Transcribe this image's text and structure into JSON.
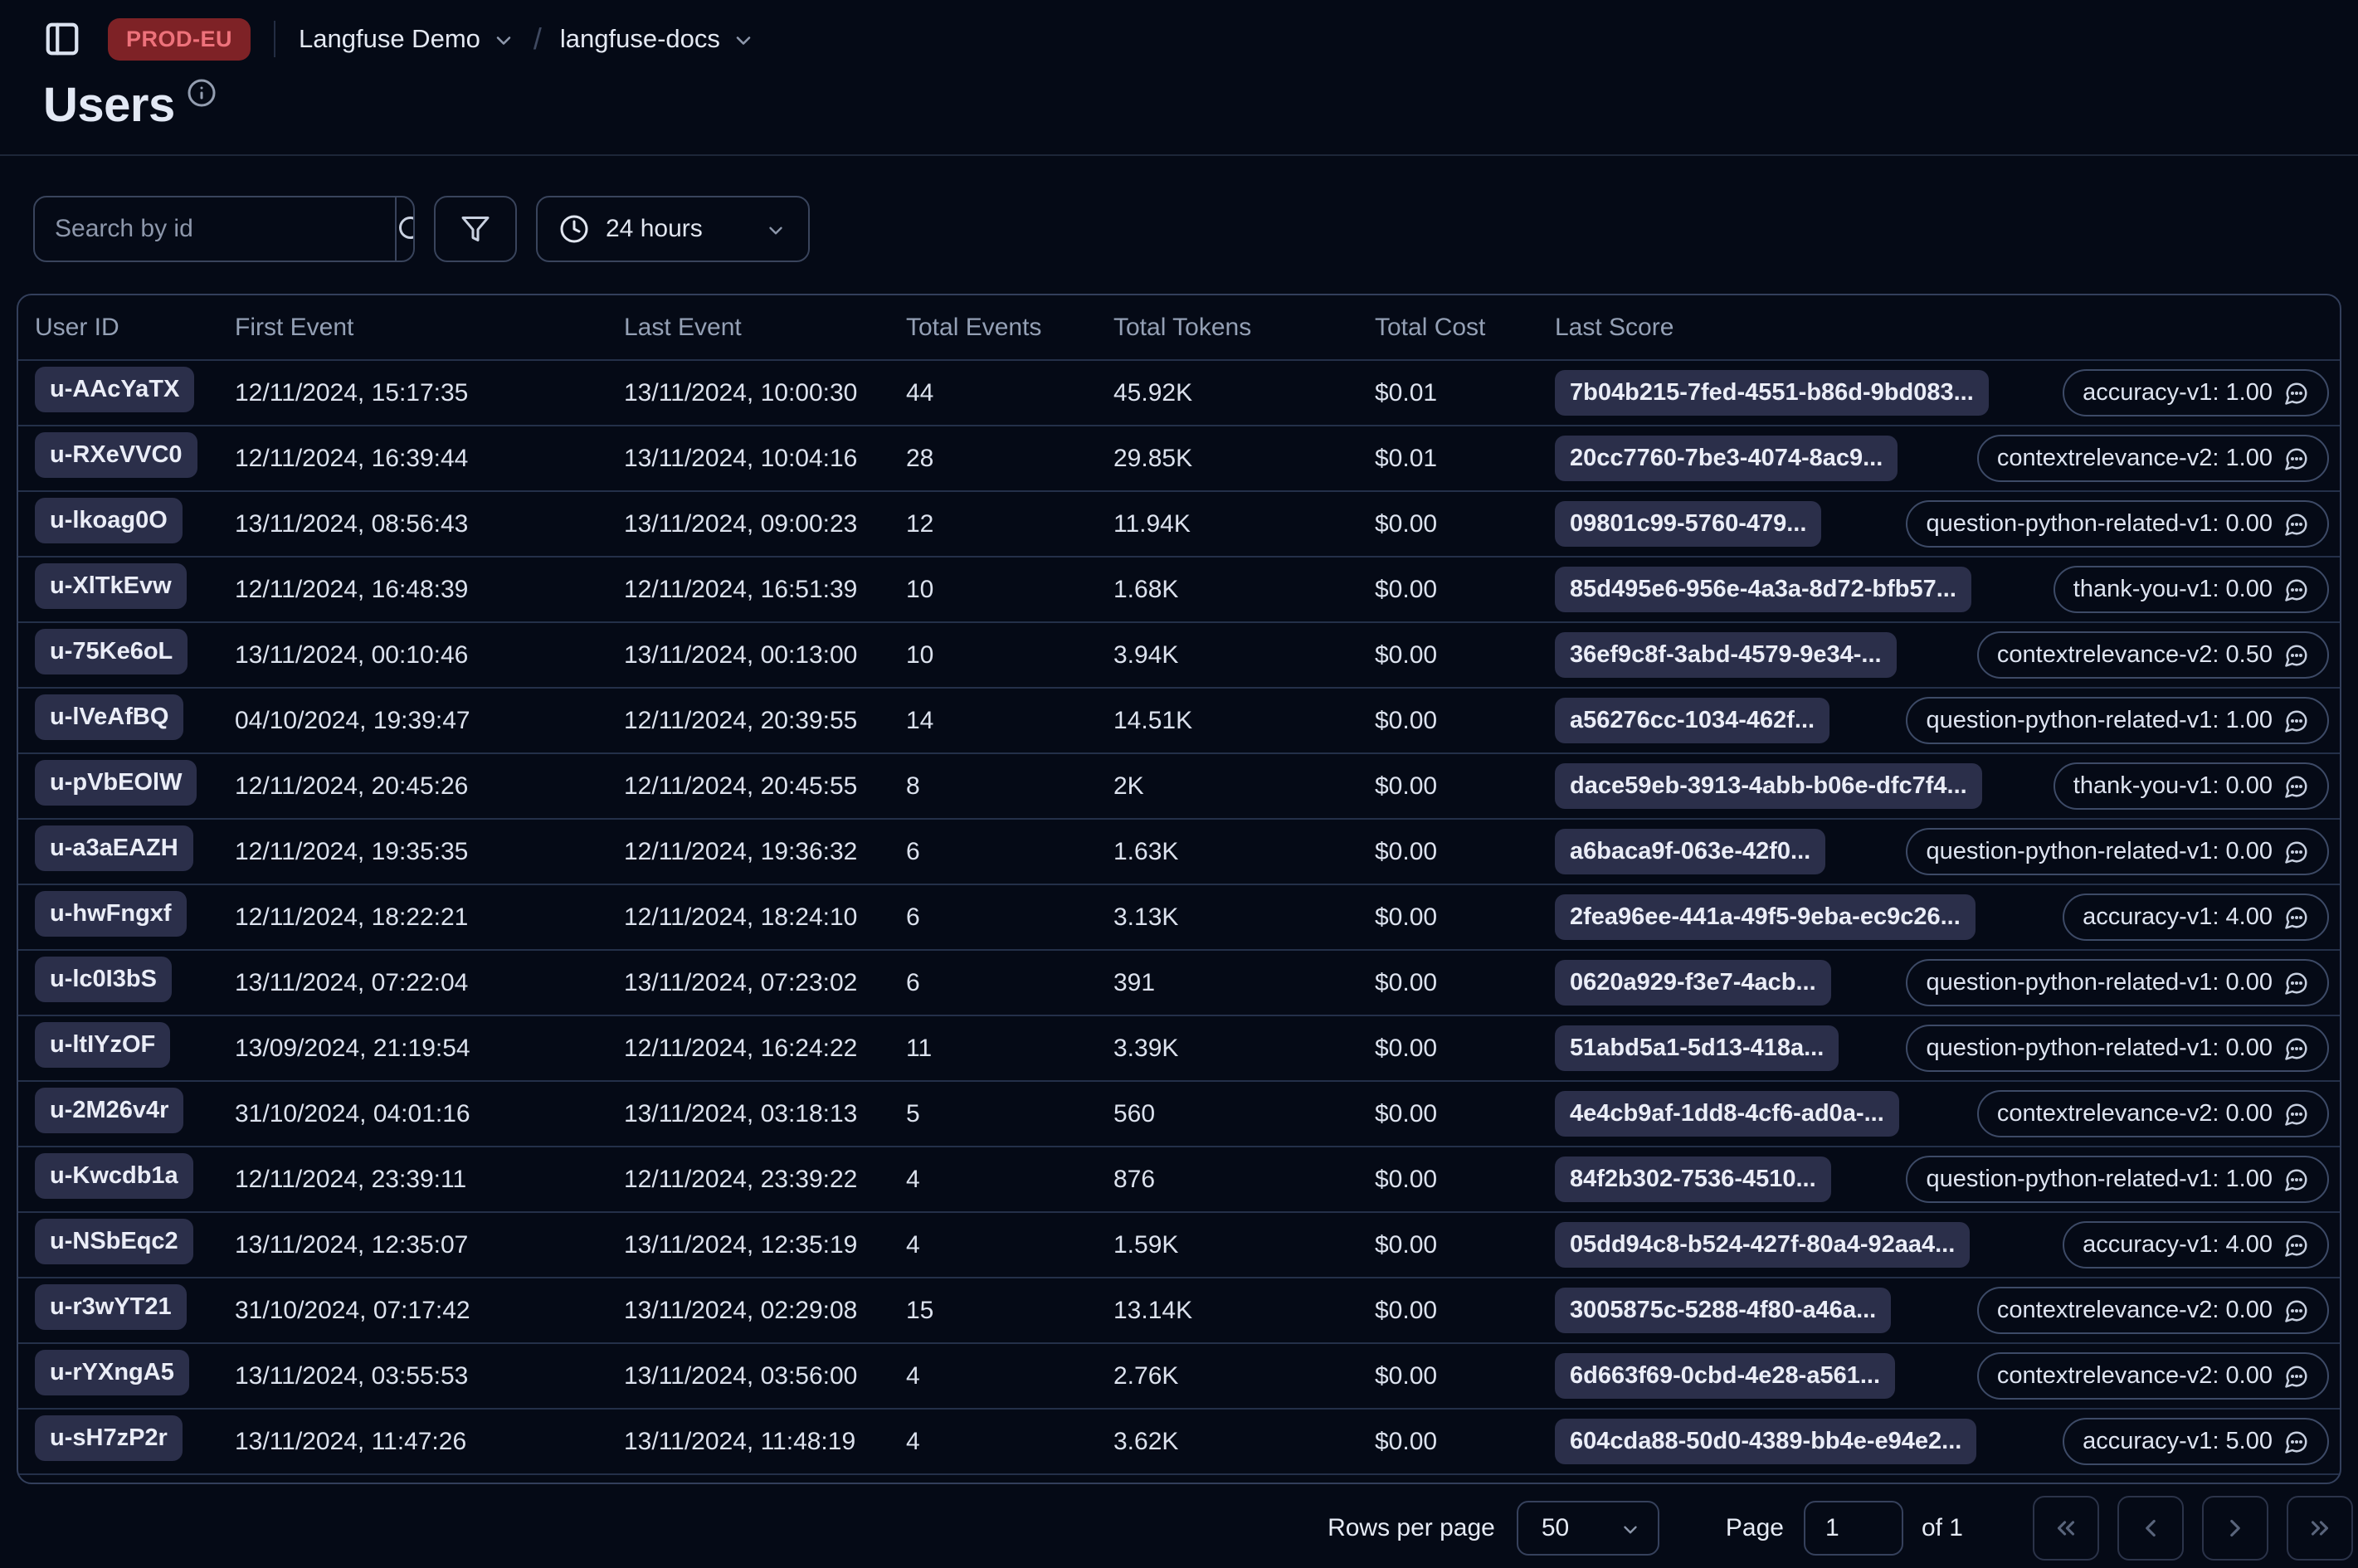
{
  "topbar": {
    "env_badge": "PROD-EU",
    "org": "Langfuse Demo",
    "project": "langfuse-docs"
  },
  "page": {
    "title": "Users"
  },
  "toolbar": {
    "search_placeholder": "Search by id",
    "time_range": "24 hours"
  },
  "table": {
    "columns": [
      "User ID",
      "First Event",
      "Last Event",
      "Total Events",
      "Total Tokens",
      "Total Cost",
      "Last Score"
    ],
    "rows": [
      {
        "user_id": "u-AAcYaTX",
        "first_event": "12/11/2024, 15:17:35",
        "last_event": "13/11/2024, 10:00:30",
        "total_events": "44",
        "total_tokens": "45.92K",
        "total_cost": "$0.01",
        "score_id": "7b04b215-7fed-4551-b86d-9bd083...",
        "score": "accuracy-v1: 1.00"
      },
      {
        "user_id": "u-RXeVVC0",
        "first_event": "12/11/2024, 16:39:44",
        "last_event": "13/11/2024, 10:04:16",
        "total_events": "28",
        "total_tokens": "29.85K",
        "total_cost": "$0.01",
        "score_id": "20cc7760-7be3-4074-8ac9...",
        "score": "contextrelevance-v2: 1.00"
      },
      {
        "user_id": "u-lkoag0O",
        "first_event": "13/11/2024, 08:56:43",
        "last_event": "13/11/2024, 09:00:23",
        "total_events": "12",
        "total_tokens": "11.94K",
        "total_cost": "$0.00",
        "score_id": "09801c99-5760-479...",
        "score": "question-python-related-v1: 0.00"
      },
      {
        "user_id": "u-XlTkEvw",
        "first_event": "12/11/2024, 16:48:39",
        "last_event": "12/11/2024, 16:51:39",
        "total_events": "10",
        "total_tokens": "1.68K",
        "total_cost": "$0.00",
        "score_id": "85d495e6-956e-4a3a-8d72-bfb57...",
        "score": "thank-you-v1: 0.00"
      },
      {
        "user_id": "u-75Ke6oL",
        "first_event": "13/11/2024, 00:10:46",
        "last_event": "13/11/2024, 00:13:00",
        "total_events": "10",
        "total_tokens": "3.94K",
        "total_cost": "$0.00",
        "score_id": "36ef9c8f-3abd-4579-9e34-...",
        "score": "contextrelevance-v2: 0.50"
      },
      {
        "user_id": "u-lVeAfBQ",
        "first_event": "04/10/2024, 19:39:47",
        "last_event": "12/11/2024, 20:39:55",
        "total_events": "14",
        "total_tokens": "14.51K",
        "total_cost": "$0.00",
        "score_id": "a56276cc-1034-462f...",
        "score": "question-python-related-v1: 1.00"
      },
      {
        "user_id": "u-pVbEOlW",
        "first_event": "12/11/2024, 20:45:26",
        "last_event": "12/11/2024, 20:45:55",
        "total_events": "8",
        "total_tokens": "2K",
        "total_cost": "$0.00",
        "score_id": "dace59eb-3913-4abb-b06e-dfc7f4...",
        "score": "thank-you-v1: 0.00"
      },
      {
        "user_id": "u-a3aEAZH",
        "first_event": "12/11/2024, 19:35:35",
        "last_event": "12/11/2024, 19:36:32",
        "total_events": "6",
        "total_tokens": "1.63K",
        "total_cost": "$0.00",
        "score_id": "a6baca9f-063e-42f0...",
        "score": "question-python-related-v1: 0.00"
      },
      {
        "user_id": "u-hwFngxf",
        "first_event": "12/11/2024, 18:22:21",
        "last_event": "12/11/2024, 18:24:10",
        "total_events": "6",
        "total_tokens": "3.13K",
        "total_cost": "$0.00",
        "score_id": "2fea96ee-441a-49f5-9eba-ec9c26...",
        "score": "accuracy-v1: 4.00"
      },
      {
        "user_id": "u-lc0I3bS",
        "first_event": "13/11/2024, 07:22:04",
        "last_event": "13/11/2024, 07:23:02",
        "total_events": "6",
        "total_tokens": "391",
        "total_cost": "$0.00",
        "score_id": "0620a929-f3e7-4acb...",
        "score": "question-python-related-v1: 0.00"
      },
      {
        "user_id": "u-ltIYzOF",
        "first_event": "13/09/2024, 21:19:54",
        "last_event": "12/11/2024, 16:24:22",
        "total_events": "11",
        "total_tokens": "3.39K",
        "total_cost": "$0.00",
        "score_id": "51abd5a1-5d13-418a...",
        "score": "question-python-related-v1: 0.00"
      },
      {
        "user_id": "u-2M26v4r",
        "first_event": "31/10/2024, 04:01:16",
        "last_event": "13/11/2024, 03:18:13",
        "total_events": "5",
        "total_tokens": "560",
        "total_cost": "$0.00",
        "score_id": "4e4cb9af-1dd8-4cf6-ad0a-...",
        "score": "contextrelevance-v2: 0.00"
      },
      {
        "user_id": "u-Kwcdb1a",
        "first_event": "12/11/2024, 23:39:11",
        "last_event": "12/11/2024, 23:39:22",
        "total_events": "4",
        "total_tokens": "876",
        "total_cost": "$0.00",
        "score_id": "84f2b302-7536-4510...",
        "score": "question-python-related-v1: 1.00"
      },
      {
        "user_id": "u-NSbEqc2",
        "first_event": "13/11/2024, 12:35:07",
        "last_event": "13/11/2024, 12:35:19",
        "total_events": "4",
        "total_tokens": "1.59K",
        "total_cost": "$0.00",
        "score_id": "05dd94c8-b524-427f-80a4-92aa4...",
        "score": "accuracy-v1: 4.00"
      },
      {
        "user_id": "u-r3wYT21",
        "first_event": "31/10/2024, 07:17:42",
        "last_event": "13/11/2024, 02:29:08",
        "total_events": "15",
        "total_tokens": "13.14K",
        "total_cost": "$0.00",
        "score_id": "3005875c-5288-4f80-a46a...",
        "score": "contextrelevance-v2: 0.00"
      },
      {
        "user_id": "u-rYXngA5",
        "first_event": "13/11/2024, 03:55:53",
        "last_event": "13/11/2024, 03:56:00",
        "total_events": "4",
        "total_tokens": "2.76K",
        "total_cost": "$0.00",
        "score_id": "6d663f69-0cbd-4e28-a561...",
        "score": "contextrelevance-v2: 0.00"
      },
      {
        "user_id": "u-sH7zP2r",
        "first_event": "13/11/2024, 11:47:26",
        "last_event": "13/11/2024, 11:48:19",
        "total_events": "4",
        "total_tokens": "3.62K",
        "total_cost": "$0.00",
        "score_id": "604cda88-50d0-4389-bb4e-e94e2...",
        "score": "accuracy-v1: 5.00"
      }
    ]
  },
  "pagination": {
    "rows_per_page_label": "Rows per page",
    "rows_per_page": "50",
    "page_label": "Page",
    "page": "1",
    "of_label": "of 1"
  },
  "icons": [
    "panel-left-icon",
    "info-icon",
    "search-icon",
    "filter-icon",
    "clock-icon",
    "chevron-down-icon",
    "comment-icon",
    "chevrons-left-icon",
    "chevron-left-icon",
    "chevron-right-icon",
    "chevrons-right-icon"
  ],
  "colors": {
    "page_bg": "#050a16",
    "env_badge_bg": "#7e2226",
    "env_badge_text": "#ee727b",
    "chip_bg": "#2b2f4a",
    "border": "#39445c",
    "row_separator": "#243049",
    "header_text": "#94a0b5",
    "body_text": "#dce2ee"
  }
}
